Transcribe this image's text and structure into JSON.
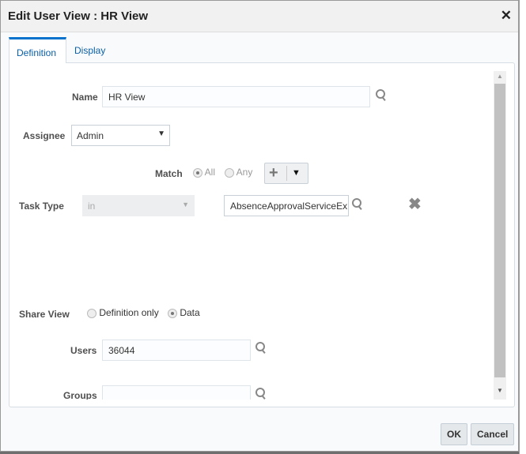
{
  "dialog": {
    "title": "Edit User View : HR View",
    "close": "✕"
  },
  "tabs": [
    {
      "label": "Definition"
    },
    {
      "label": "Display"
    }
  ],
  "form": {
    "name": {
      "label": "Name",
      "value": "HR View"
    },
    "assignee": {
      "label": "Assignee",
      "value": "Admin"
    },
    "match": {
      "label": "Match",
      "options": [
        "All",
        "Any"
      ],
      "selected": "All"
    },
    "task_type": {
      "label": "Task Type",
      "operator": "in",
      "value": "AbsenceApprovalServiceEx"
    },
    "share_view": {
      "label": "Share View",
      "options": [
        "Definition only",
        "Data"
      ],
      "selected": "Data"
    },
    "users": {
      "label": "Users",
      "value": "36044"
    },
    "groups": {
      "label": "Groups",
      "value": ""
    }
  },
  "buttons": {
    "ok": "OK",
    "cancel": "Cancel"
  }
}
